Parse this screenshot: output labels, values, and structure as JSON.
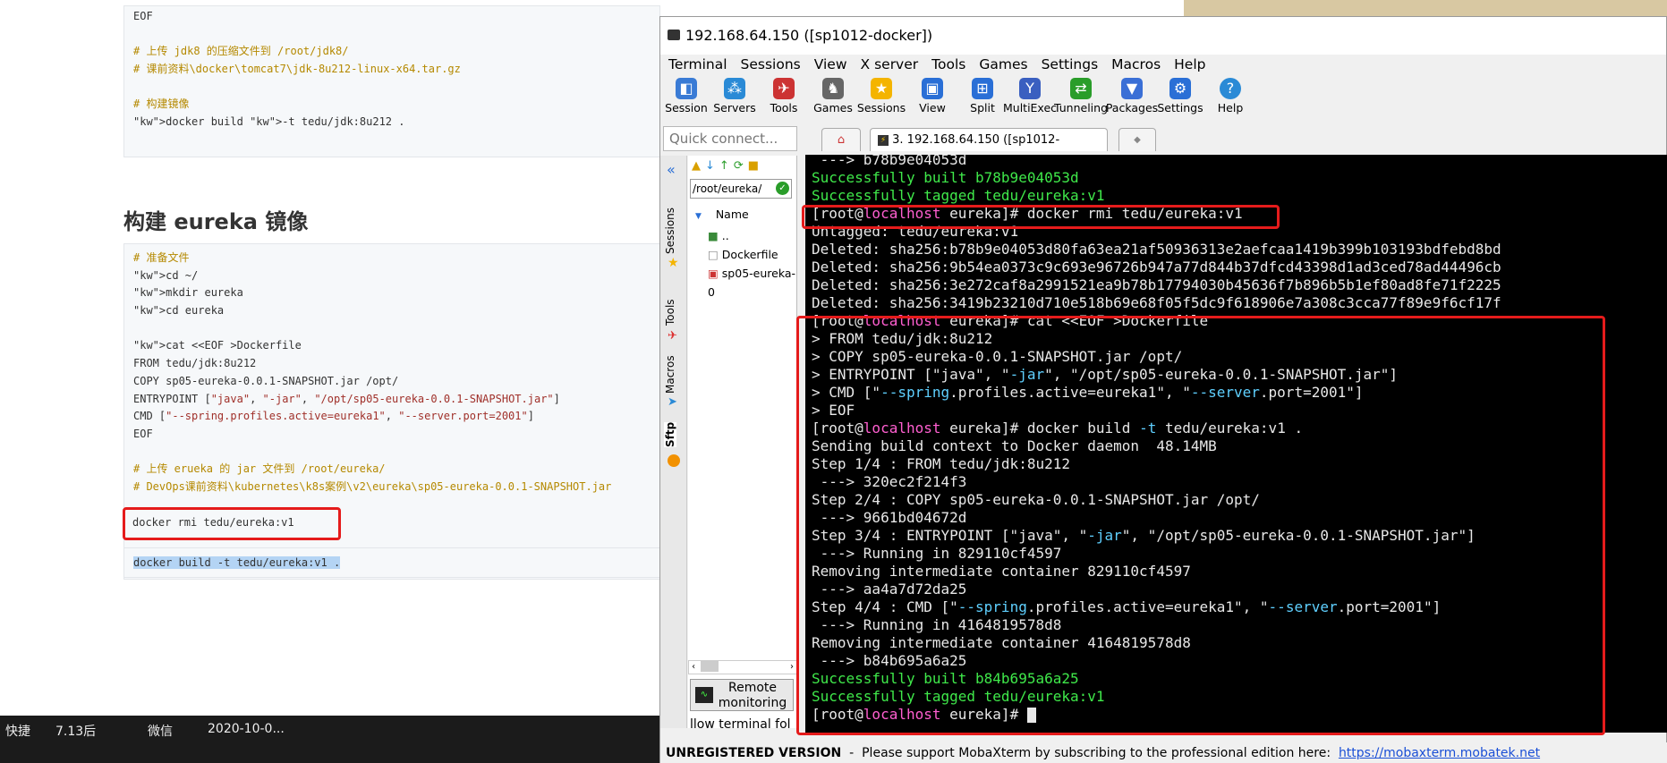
{
  "doc": {
    "box1": [
      "EOF",
      "",
      "# 上传 jdk8 的压缩文件到 /root/jdk8/",
      "# 课前资料\\docker\\tomcat7\\jdk-8u212-linux-x64.tar.gz",
      "",
      "# 构建镜像",
      "docker build -t tedu/jdk:8u212 ."
    ],
    "heading": "构建 eureka 镜像",
    "box2": [
      "# 准备文件",
      "cd ~/",
      "mkdir eureka",
      "cd eureka",
      "",
      "cat <<EOF >Dockerfile",
      "FROM tedu/jdk:8u212",
      "COPY sp05-eureka-0.0.1-SNAPSHOT.jar /opt/",
      "ENTRYPOINT [\"java\", \"-jar\", \"/opt/sp05-eureka-0.0.1-SNAPSHOT.jar\"]",
      "CMD [\"--spring.profiles.active=eureka1\", \"--server.port=2001\"]",
      "EOF",
      "",
      "# 上传 erueka 的 jar 文件到 /root/eureka/",
      "# DevOps课前资料\\kubernetes\\k8s案例\\v2\\eureka\\sp05-eureka-0.0.1-SNAPSHOT.jar"
    ],
    "box3": "docker rmi tedu/eureka:v1",
    "box4": "docker build -t tedu/eureka:v1 ."
  },
  "taskbar": {
    "i1": "快捷",
    "i2": "7.13后",
    "i3": "微信",
    "i4": "2020-10-0..."
  },
  "moba": {
    "title": "192.168.64.150 ([sp1012-docker])",
    "menu": [
      "Terminal",
      "Sessions",
      "View",
      "X server",
      "Tools",
      "Games",
      "Settings",
      "Macros",
      "Help"
    ],
    "toolbar": [
      "Session",
      "Servers",
      "Tools",
      "Games",
      "Sessions",
      "View",
      "Split",
      "MultiExec",
      "Tunneling",
      "Packages",
      "Settings",
      "Help"
    ],
    "quick_connect": "Quick connect...",
    "tab_label": "3. 192.168.64.150 ([sp1012-docker])",
    "side_tabs": [
      "Sessions",
      "Tools",
      "Macros",
      "Sftp"
    ],
    "sftp": {
      "path": "/root/eureka/",
      "header": "Name",
      "files": [
        "..",
        "Dockerfile",
        "sp05-eureka-0"
      ],
      "remote": "Remote monitoring",
      "follow": "llow terminal fol"
    },
    "status": "UNREGISTERED VERSION",
    "status_msg": "  -  Please support MobaXterm by subscribing to the professional edition here:  ",
    "status_link": "https://mobaxterm.mobatek.net",
    "terminal": [
      [
        " ---> b78b9e04053d",
        ""
      ],
      [
        "Successfully built b78b9e04053d",
        "g"
      ],
      [
        "Successfully tagged tedu/eureka:v1",
        "g"
      ],
      [
        "PROMPT",
        "# docker rmi tedu/eureka:v1"
      ],
      [
        "Untagged: tedu/eureka:v1",
        ""
      ],
      [
        "Deleted: sha256:b78b9e04053d80fa63ea21af50936313e2aefcaa1419b399b103193bdfebd8bd",
        ""
      ],
      [
        "Deleted: sha256:9b54ea0373c9c693e96726b947a77d844b37dfcd43398d1ad3ced78ad44496cb",
        ""
      ],
      [
        "Deleted: sha256:3e272caf8a2991521ea9b78b17794030b45636f7b896b5b1ef80ad8fe71f2225",
        ""
      ],
      [
        "Deleted: sha256:3419b23210d710e518b69e68f05f5dc9f618906e7a308c3cca77f89e9f6cf17f",
        ""
      ],
      [
        "PROMPT",
        "# cat <<EOF >Dockerfile"
      ],
      [
        "> FROM tedu/jdk:8u212",
        ""
      ],
      [
        "> COPY sp05-eureka-0.0.1-SNAPSHOT.jar /opt/",
        ""
      ],
      [
        "> ENTRYPOINT [\"java\", \"-jar\", \"/opt/sp05-eureka-0.0.1-SNAPSHOT.jar\"]",
        ""
      ],
      [
        "> CMD [\"--spring.profiles.active=eureka1\", \"--server.port=2001\"]",
        ""
      ],
      [
        "> EOF",
        ""
      ],
      [
        "PROMPT",
        "# docker build -t tedu/eureka:v1 ."
      ],
      [
        "Sending build context to Docker daemon  48.14MB",
        ""
      ],
      [
        "Step 1/4 : FROM tedu/jdk:8u212",
        ""
      ],
      [
        " ---> 320ec2f214f3",
        ""
      ],
      [
        "Step 2/4 : COPY sp05-eureka-0.0.1-SNAPSHOT.jar /opt/",
        ""
      ],
      [
        " ---> 9661bd04672d",
        ""
      ],
      [
        "Step 3/4 : ENTRYPOINT [\"java\", \"-jar\", \"/opt/sp05-eureka-0.0.1-SNAPSHOT.jar\"]",
        ""
      ],
      [
        " ---> Running in 829110cf4597",
        ""
      ],
      [
        "Removing intermediate container 829110cf4597",
        ""
      ],
      [
        " ---> aa4a7d72da25",
        ""
      ],
      [
        "Step 4/4 : CMD [\"--spring.profiles.active=eureka1\", \"--server.port=2001\"]",
        ""
      ],
      [
        " ---> Running in 4164819578d8",
        ""
      ],
      [
        "Removing intermediate container 4164819578d8",
        ""
      ],
      [
        " ---> b84b695a6a25",
        ""
      ],
      [
        "Successfully built b84b695a6a25",
        "g"
      ],
      [
        "Successfully tagged tedu/eureka:v1",
        "g"
      ],
      [
        "PROMPT",
        "# "
      ]
    ],
    "prompt_user": "root",
    "prompt_host": "localhost",
    "prompt_dir": "eureka"
  }
}
